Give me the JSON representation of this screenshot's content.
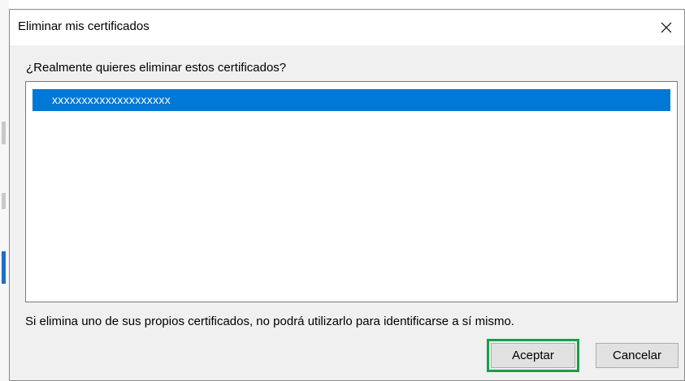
{
  "dialog": {
    "title": "Eliminar mis certificados",
    "close_icon": "close-icon",
    "question": "¿Realmente quieres eliminar estos certificados?",
    "certificates": [
      {
        "name": "xxxxxxxxxxxxxxxxxxxx",
        "selected": true
      }
    ],
    "warning": "Si elimina uno de sus propios certificados, no podrá utilizarlo para identificarse a sí mismo.",
    "buttons": {
      "accept_label": "Aceptar",
      "cancel_label": "Cancelar"
    }
  },
  "colors": {
    "selection": "#0078d7",
    "highlight_outline": "#15a046"
  }
}
